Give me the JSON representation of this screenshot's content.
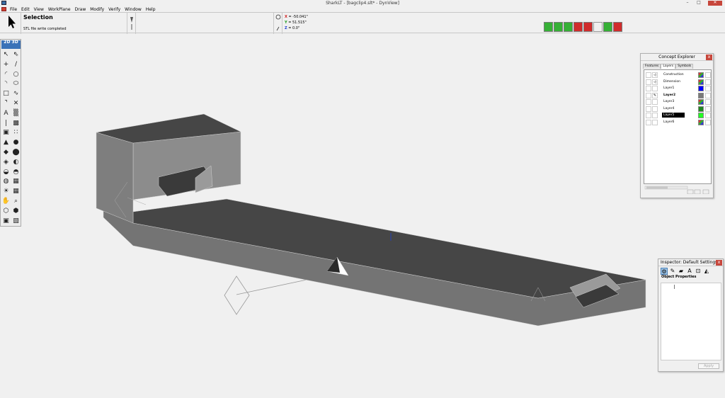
{
  "window": {
    "title": "SharkLT - [bagclip4.slt* - DynView]",
    "minimize": "–",
    "maximize": "□",
    "close": "✕"
  },
  "menu": [
    "File",
    "Edit",
    "View",
    "WorkPlane",
    "Draw",
    "Modify",
    "Verify",
    "Window",
    "Help"
  ],
  "status": {
    "title": "Selection",
    "message": "STL file write completed",
    "coords": {
      "x_label": "X",
      "x_value": "= -50.041\"",
      "y_label": "Y",
      "y_value": "= 51.515\"",
      "z_label": "Z",
      "z_value": "= 0.0\""
    },
    "coord_colors": {
      "x": "#d02020",
      "y": "#1a9a1a",
      "z": "#2040d0"
    }
  },
  "toolbox": {
    "mode_2d": "2D",
    "mode_3d": "3D",
    "tools": [
      {
        "name": "select-arrow-icon",
        "glyph": "↖"
      },
      {
        "name": "select-arrow-outline-icon",
        "glyph": "⇖"
      },
      {
        "name": "point-icon",
        "glyph": "+"
      },
      {
        "name": "line-icon",
        "glyph": "/"
      },
      {
        "name": "arc-icon",
        "glyph": "◜"
      },
      {
        "name": "circle-icon",
        "glyph": "○"
      },
      {
        "name": "arc-3pt-icon",
        "glyph": "◝"
      },
      {
        "name": "ellipse-icon",
        "glyph": "⬭"
      },
      {
        "name": "rectangle-icon",
        "glyph": "□"
      },
      {
        "name": "spline-icon",
        "glyph": "∿"
      },
      {
        "name": "fillet-icon",
        "glyph": "⌝"
      },
      {
        "name": "trim-icon",
        "glyph": "✕"
      },
      {
        "name": "text-icon",
        "glyph": "A"
      },
      {
        "name": "hatch-icon",
        "glyph": "▒"
      },
      {
        "name": "dimension-icon",
        "glyph": "|"
      },
      {
        "name": "pattern-icon",
        "glyph": "▩"
      },
      {
        "name": "box-icon",
        "glyph": "▣"
      },
      {
        "name": "array-icon",
        "glyph": "∷"
      },
      {
        "name": "extrude-icon",
        "glyph": "▲"
      },
      {
        "name": "sphere-icon",
        "glyph": "●"
      },
      {
        "name": "solid-cut-icon",
        "glyph": "◆"
      },
      {
        "name": "cylinder-icon",
        "glyph": "⬤"
      },
      {
        "name": "loft-icon",
        "glyph": "◈"
      },
      {
        "name": "revolve-icon",
        "glyph": "◐"
      },
      {
        "name": "shell-icon",
        "glyph": "◒"
      },
      {
        "name": "boolean-icon",
        "glyph": "◓"
      },
      {
        "name": "blend-icon",
        "glyph": "◍"
      },
      {
        "name": "surface-icon",
        "glyph": "▦"
      },
      {
        "name": "render-icon",
        "glyph": "☀"
      },
      {
        "name": "grid-icon",
        "glyph": "▦"
      },
      {
        "name": "pan-hand-icon",
        "glyph": "✋"
      },
      {
        "name": "zoom-icon",
        "glyph": "⌕"
      },
      {
        "name": "view-iso-icon",
        "glyph": "⬡"
      },
      {
        "name": "view-orbit-icon",
        "glyph": "⬢"
      },
      {
        "name": "view-cube-icon",
        "glyph": "▣"
      },
      {
        "name": "view-shaded-icon",
        "glyph": "▧"
      }
    ]
  },
  "snap_toolbar": {
    "buttons": [
      {
        "name": "snap-endpoint-button",
        "color": "green"
      },
      {
        "name": "snap-midpoint-button",
        "color": "green"
      },
      {
        "name": "snap-center-button",
        "color": "green"
      },
      {
        "name": "snap-intersection-button",
        "color": "red"
      },
      {
        "name": "snap-nearest-button",
        "color": "red"
      },
      {
        "name": "snap-grid-button",
        "color": "gray"
      },
      {
        "name": "snap-green-figure-button",
        "color": "green"
      },
      {
        "name": "snap-red-figure-button",
        "color": "red"
      }
    ]
  },
  "concept_explorer": {
    "title": "Concept Explorer",
    "close": "x",
    "tabs": [
      "Features",
      "Layers",
      "Symbols"
    ],
    "active_tab": "Layers",
    "layers": [
      {
        "name": "Construction",
        "swatch": "",
        "bold": false,
        "selected": false,
        "icon": "◁"
      },
      {
        "name": "Dimension",
        "swatch": "",
        "bold": false,
        "selected": false,
        "icon": "◁"
      },
      {
        "name": "Layer1",
        "swatch": "#0000ff",
        "bold": false,
        "selected": false,
        "icon": ""
      },
      {
        "name": "Layer2",
        "swatch": "#7a7a7a",
        "bold": true,
        "selected": false,
        "icon": "✎"
      },
      {
        "name": "Layer3",
        "swatch": "",
        "bold": false,
        "selected": false,
        "icon": ""
      },
      {
        "name": "Layer4",
        "swatch": "#228822",
        "bold": false,
        "selected": false,
        "icon": ""
      },
      {
        "name": "Layer5",
        "swatch": "#22ff22",
        "bold": false,
        "selected": true,
        "icon": ""
      },
      {
        "name": "Layer6",
        "swatch": "",
        "bold": false,
        "selected": false,
        "icon": ""
      }
    ]
  },
  "inspector": {
    "title": "Inspector: Default Settings",
    "close": "x",
    "section": "Object Properties",
    "apply_label": "Apply"
  },
  "colors": {
    "part_top": "#464646",
    "part_side": "#8c8c8c",
    "part_front": "#747474",
    "accent_blue": "#3a72b8"
  }
}
